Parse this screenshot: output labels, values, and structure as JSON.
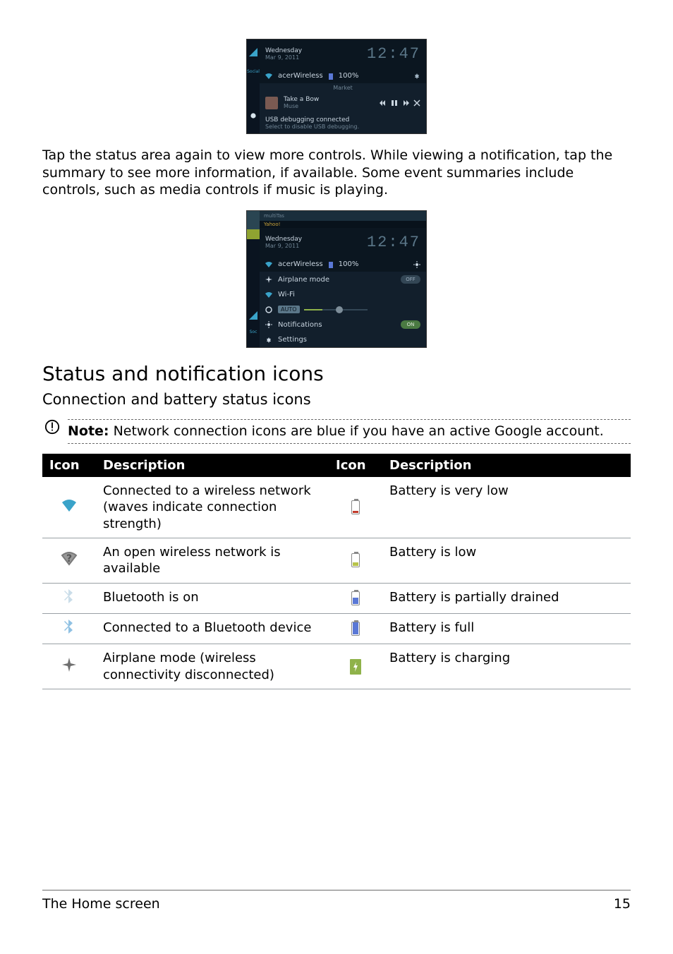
{
  "shot1": {
    "day": "Wednesday",
    "date": "Mar 9, 2011",
    "time": "12:47",
    "wifi_ssid": "acerWireless",
    "battery_pct": "100%",
    "social_label": "Social",
    "market_label": "Market",
    "now_playing_title": "Take a Bow",
    "now_playing_artist": "Muse",
    "usb_title": "USB debugging connected",
    "usb_sub": "Select to disable USB debugging."
  },
  "para1": "Tap the status area again to view more controls. While viewing a notification, tap the summary to see more information, if available. Some event summaries include controls, such as media controls if music is playing.",
  "shot2": {
    "day": "Wednesday",
    "date": "Mar 9, 2011",
    "time": "12:47",
    "wifi_ssid": "acerWireless",
    "battery_pct": "100%",
    "airplane_label": "Airplane mode",
    "airplane_state": "OFF",
    "wifi_label": "Wi-Fi",
    "auto_label": "AUTO",
    "notifications_label": "Notifications",
    "notifications_state": "ON",
    "settings_label": "Settings"
  },
  "heading": "Status and notification icons",
  "subheading": "Connection and battery status icons",
  "note_label": "Note:",
  "note_text": " Network connection icons are blue if you have an active Google account.",
  "table": {
    "headers": {
      "icon": "Icon",
      "description": "Description"
    },
    "left": [
      "Connected to a wireless network (waves indicate connection strength)",
      "An open wireless network is available",
      "Bluetooth is on",
      "Connected to a Bluetooth device",
      "Airplane mode (wireless connectivity disconnected)"
    ],
    "right": [
      "Battery is very low",
      "Battery is low",
      "Battery is partially drained",
      "Battery is full",
      "Battery is charging"
    ]
  },
  "footer": {
    "title": "The Home screen",
    "page": "15"
  }
}
